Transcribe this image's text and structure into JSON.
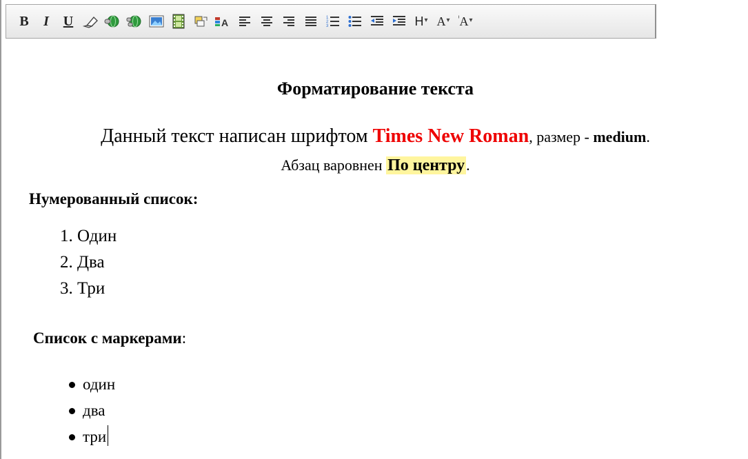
{
  "toolbar": {
    "bold_label": "B",
    "italic_label": "I",
    "underline_label": "U",
    "heading_label": "H",
    "font_size_label": "A",
    "font_color_label": "A",
    "dropdown_glyph": "▾",
    "icons": [
      "eraser-icon",
      "link-icon",
      "unlink-icon",
      "image-icon",
      "video-icon",
      "paint-icon",
      "text-color-icon",
      "align-left-icon",
      "align-center-icon",
      "align-right-icon",
      "align-justify-icon",
      "numbered-list-icon",
      "bulleted-list-icon",
      "outdent-icon",
      "indent-icon"
    ]
  },
  "document": {
    "title": "Форматирование текста",
    "para1_a": "Данный текст написан шрифтом ",
    "para1_font": "Times New Roman",
    "para1_b": ", размер - ",
    "para1_size": "medium",
    "para1_c": ".",
    "para2_a": "Абзац варовнен ",
    "para2_hl": "По центру",
    "para2_c": ".",
    "numbered_heading": "Нумерованный список:",
    "numbered_items": [
      "Один",
      "Два",
      "Три"
    ],
    "bulleted_heading": "Список с маркерами",
    "bulleted_heading_colon": ":",
    "bulleted_items": [
      "один",
      "два",
      "три"
    ]
  },
  "colors": {
    "red_text": "#ee0000",
    "highlight": "#fff59e",
    "toolbar_bg": "#e6e6e6"
  }
}
